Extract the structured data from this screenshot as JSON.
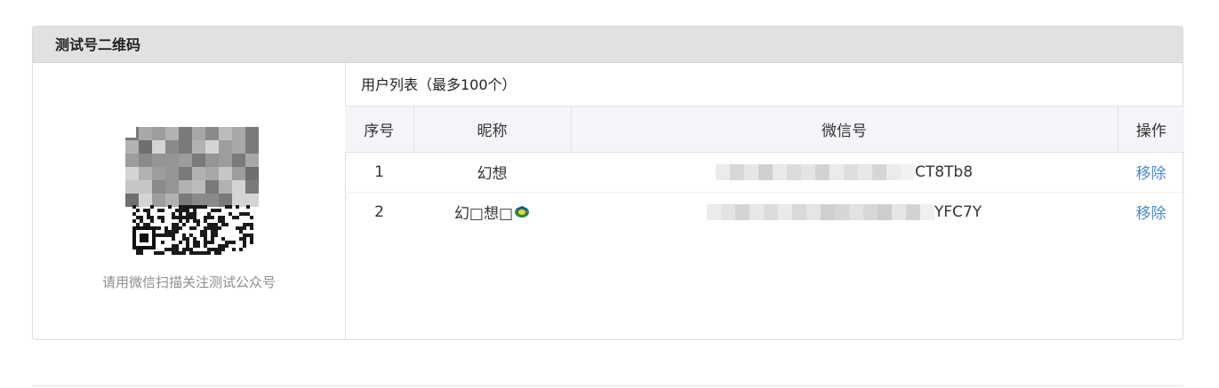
{
  "panel": {
    "title": "测试号二维码"
  },
  "qr": {
    "caption": "请用微信扫描关注测试公众号"
  },
  "user_list": {
    "title": "用户列表（最多100个）",
    "columns": [
      "序号",
      "昵称",
      "微信号",
      "操作"
    ],
    "rows": [
      {
        "index": "1",
        "nickname": "幻想",
        "wechat_id_visible": "CT8Tb8",
        "action": "移除"
      },
      {
        "index": "2",
        "nickname": "幻□想□",
        "wechat_id_visible": "YFC7Y",
        "action": "移除"
      }
    ]
  },
  "colors": {
    "header_bg": "#e1e1e1",
    "table_header_bg": "#f4f5f8",
    "link": "#4a8bd6",
    "caption": "#8c8c8c"
  },
  "icons": {
    "nickname_emoji": "green-circle-arrow-icon"
  }
}
